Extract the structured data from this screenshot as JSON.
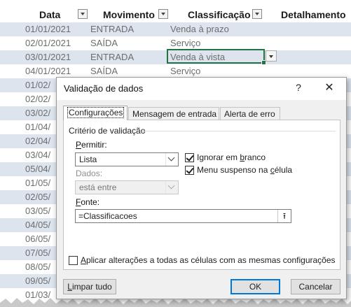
{
  "sheet": {
    "headers": [
      "Data",
      "Movimento",
      "Classificação",
      "Detalhamento"
    ],
    "rows": [
      {
        "date": "01/01/2021",
        "mov": "ENTRADA",
        "class": "Venda à prazo"
      },
      {
        "date": "02/01/2021",
        "mov": "SAÍDA",
        "class": "Serviço"
      },
      {
        "date": "03/01/2021",
        "mov": "ENTRADA",
        "class": "Venda à vista"
      },
      {
        "date": "04/01/2021",
        "mov": "SAÍDA",
        "class": "Serviço"
      },
      {
        "date": "01/02/"
      },
      {
        "date": "02/02/"
      },
      {
        "date": "03/02/"
      },
      {
        "date": "01/04/"
      },
      {
        "date": "02/04/"
      },
      {
        "date": "03/04/"
      },
      {
        "date": "05/04/"
      },
      {
        "date": "01/05/"
      },
      {
        "date": "02/05/"
      },
      {
        "date": "03/05/"
      },
      {
        "date": "04/05/"
      },
      {
        "date": "06/05/"
      },
      {
        "date": "07/05/"
      },
      {
        "date": "08/05/"
      },
      {
        "date": "09/05/"
      },
      {
        "date": "01/03/"
      }
    ]
  },
  "dialog": {
    "title": "Validação de dados",
    "help": "?",
    "close": "✕",
    "tabs": [
      "Configurações",
      "Mensagem de entrada",
      "Alerta de erro"
    ],
    "group_label": "Critério de validação",
    "allow": {
      "label": "Permitir:",
      "value": "Lista"
    },
    "data": {
      "label": "Dados:",
      "value": "está entre"
    },
    "ignore_blank": {
      "label": "Ignorar em branco",
      "checked": true
    },
    "in_cell_dropdown": {
      "label": "Menu suspenso na célula",
      "checked": true
    },
    "source": {
      "label": "Fonte:",
      "value": "=Classificacoes"
    },
    "apply_all": {
      "label": "Aplicar alterações a todas as células com as mesmas configurações",
      "checked": false
    },
    "buttons": {
      "clear": "Limpar tudo",
      "ok": "OK",
      "cancel": "Cancelar"
    }
  },
  "colors": {
    "band": "#dde4ee",
    "active_border": "#217346",
    "default_button": "#0078d7"
  }
}
